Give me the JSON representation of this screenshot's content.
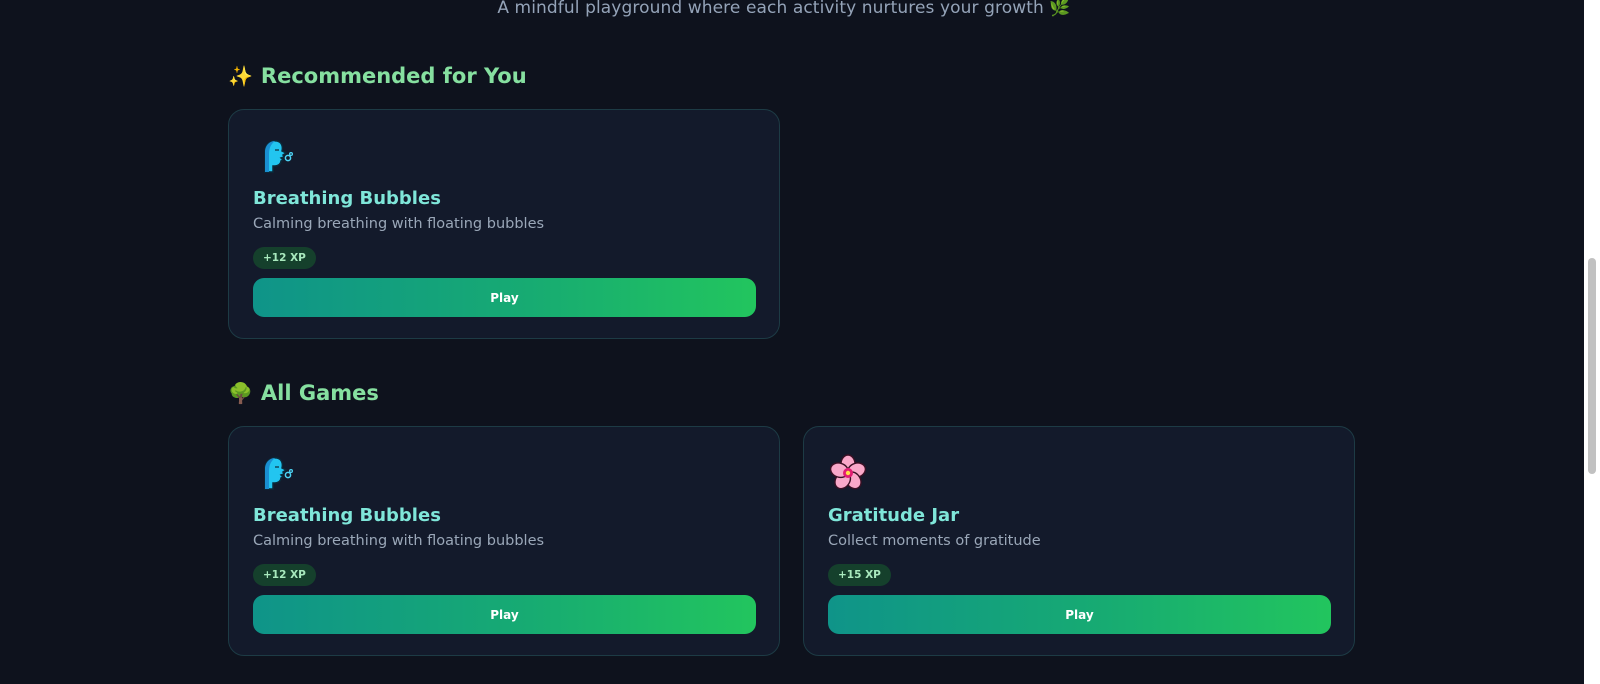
{
  "header": {
    "subtitle": "A mindful playground where each activity nurtures your growth 🌿"
  },
  "recommended": {
    "icon": "sparkles-icon",
    "emoji": "✨",
    "title": "Recommended for You",
    "cards": [
      {
        "icon": "person-blowing-icon",
        "title": "Breathing Bubbles",
        "description": "Calming breathing with floating bubbles",
        "xp": "+12 XP",
        "button": "Play"
      }
    ]
  },
  "all_games": {
    "icon": "tree-icon",
    "emoji": "🌳",
    "title": "All Games",
    "cards": [
      {
        "icon": "person-blowing-icon",
        "title": "Breathing Bubbles",
        "description": "Calming breathing with floating bubbles",
        "xp": "+12 XP",
        "button": "Play"
      },
      {
        "icon": "cherry-blossom-icon",
        "title": "Gratitude Jar",
        "description": "Collect moments of gratitude",
        "xp": "+15 XP",
        "button": "Play"
      }
    ]
  },
  "colors": {
    "background": "#0e121d",
    "card": "#131a2b",
    "heading": "#86e0a0",
    "card_title": "#7fe6d9",
    "button_start": "#0f9489",
    "button_end": "#22c55e"
  }
}
